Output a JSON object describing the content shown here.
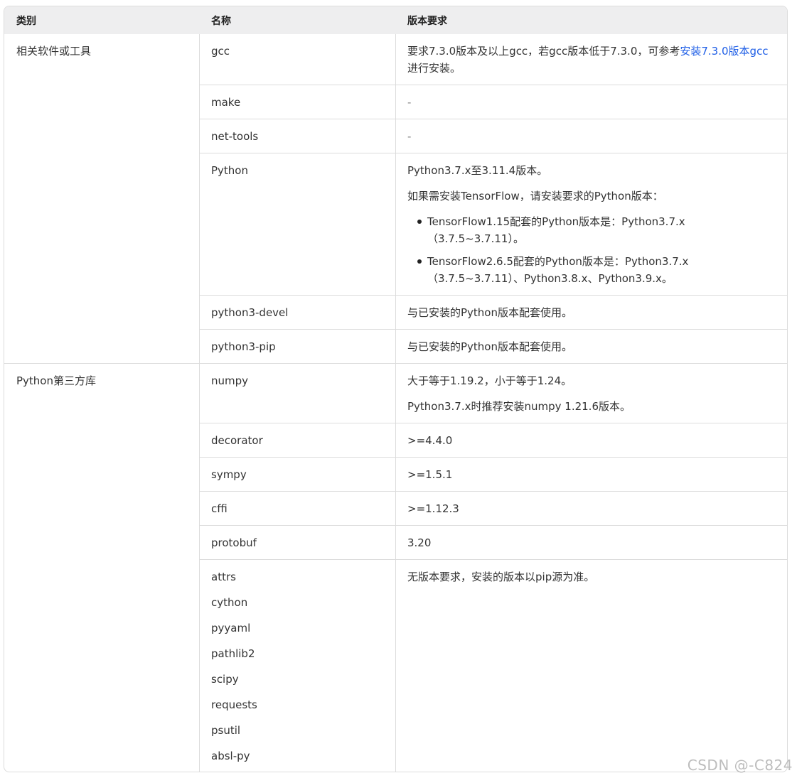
{
  "header": {
    "col1": "类别",
    "col2": "名称",
    "col3": "版本要求"
  },
  "groups": [
    {
      "category": "相关软件或工具"
    },
    {
      "category": "Python第三方库"
    }
  ],
  "rows": {
    "gcc": {
      "name": "gcc",
      "req_a": "要求7.3.0版本及以上gcc，若gcc版本低于7.3.0，可参考",
      "req_link": "安装7.3.0版本gcc",
      "req_b": "进行安装。"
    },
    "make": {
      "name": "make",
      "req": "-"
    },
    "nettools": {
      "name": "net-tools",
      "req": "-"
    },
    "python": {
      "name": "Python",
      "p1": "Python3.7.x至3.11.4版本。",
      "p2": "如果需安装TensorFlow，请安装要求的Python版本：",
      "b1_l1": "TensorFlow1.15配套的Python版本是：Python3.7.x",
      "b1_l2": "（3.7.5~3.7.11）。",
      "b2_l1": "TensorFlow2.6.5配套的Python版本是：Python3.7.x",
      "b2_l2": "（3.7.5~3.7.11）、Python3.8.x、Python3.9.x。"
    },
    "pydevel": {
      "name": "python3-devel",
      "req": "与已安装的Python版本配套使用。"
    },
    "pypip": {
      "name": "python3-pip",
      "req": "与已安装的Python版本配套使用。"
    },
    "numpy": {
      "name": "numpy",
      "req1": "大于等于1.19.2，小于等于1.24。",
      "req2": "Python3.7.x时推荐安装numpy 1.21.6版本。"
    },
    "decorator": {
      "name": "decorator",
      "req": ">=4.4.0"
    },
    "sympy": {
      "name": "sympy",
      "req": ">=1.5.1"
    },
    "cffi": {
      "name": "cffi",
      "req": ">=1.12.3"
    },
    "protobuf": {
      "name": "protobuf",
      "req": "3.20"
    },
    "misc": {
      "names": [
        "attrs",
        "cython",
        "pyyaml",
        "pathlib2",
        "scipy",
        "requests",
        "psutil",
        "absl-py"
      ],
      "req": "无版本要求，安装的版本以pip源为准。"
    }
  },
  "watermark": "CSDN @-C824"
}
